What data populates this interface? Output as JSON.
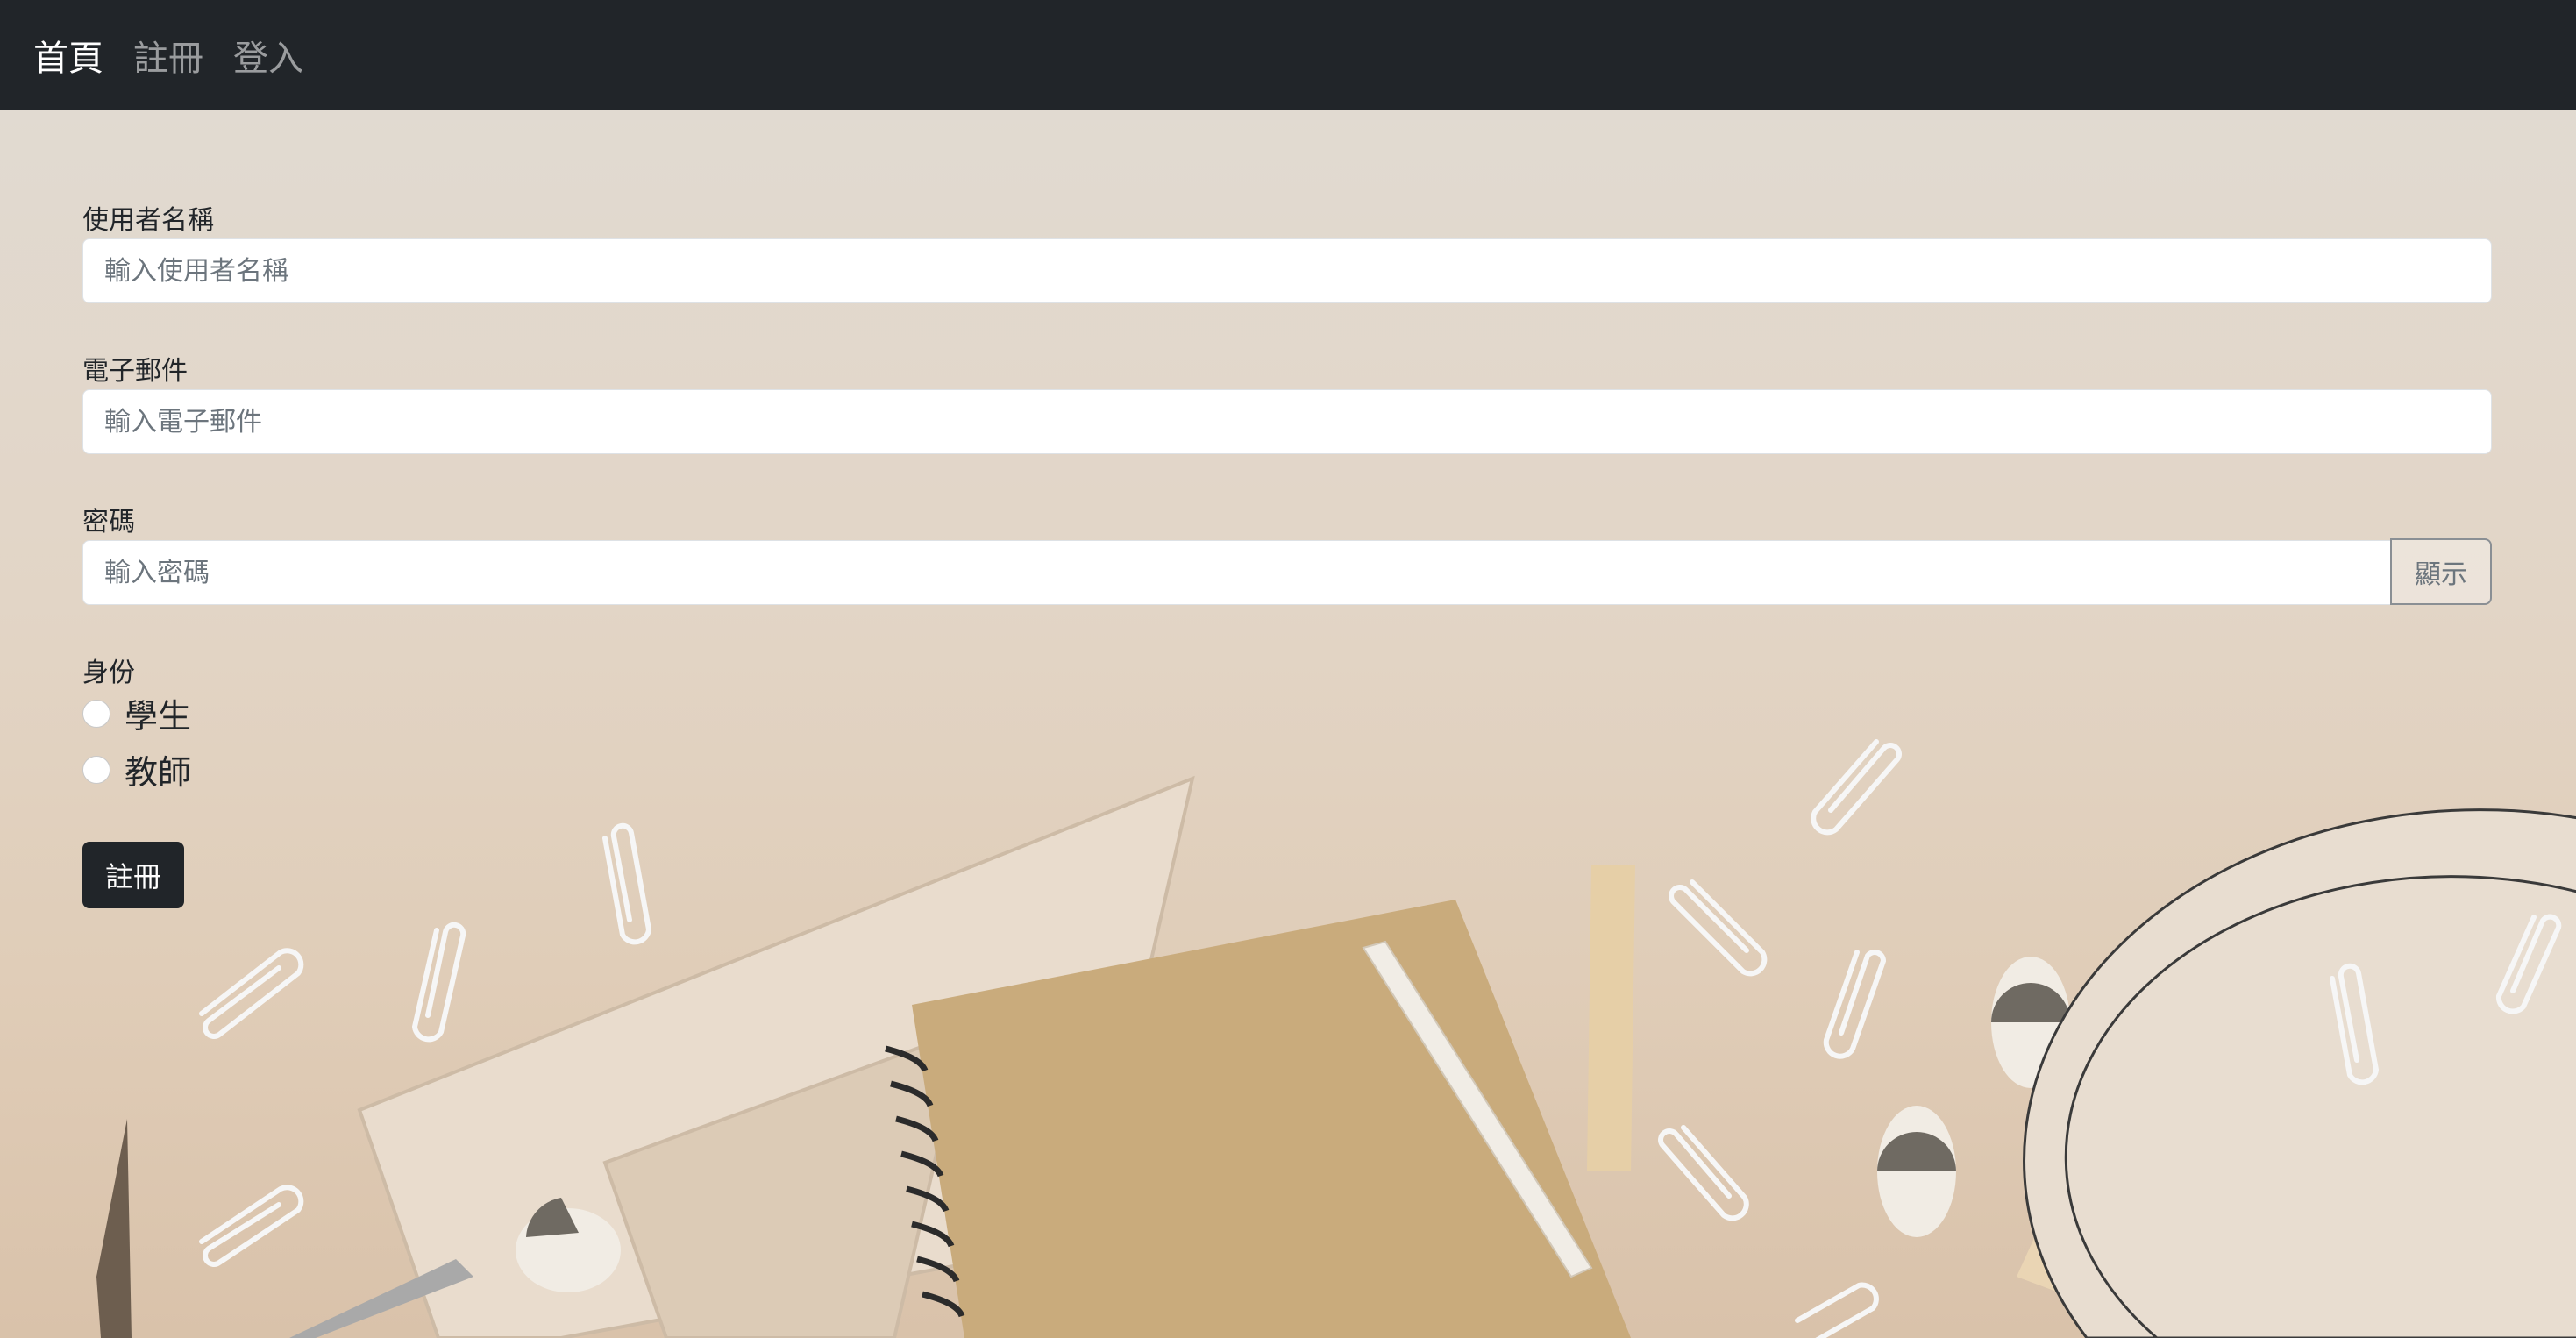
{
  "navbar": {
    "brand": "首頁",
    "links": [
      "註冊",
      "登入"
    ]
  },
  "form": {
    "username": {
      "label": "使用者名稱",
      "placeholder": "輸入使用者名稱",
      "value": ""
    },
    "email": {
      "label": "電子郵件",
      "placeholder": "輸入電子郵件",
      "value": ""
    },
    "password": {
      "label": "密碼",
      "placeholder": "輸入密碼",
      "value": "",
      "toggle_label": "顯示"
    },
    "role": {
      "label": "身份",
      "options": [
        "學生",
        "教師"
      ],
      "selected": null
    },
    "submit_label": "註冊"
  },
  "colors": {
    "navbar_bg": "#212529",
    "button_bg": "#212529",
    "background": "#e3d8cb"
  }
}
